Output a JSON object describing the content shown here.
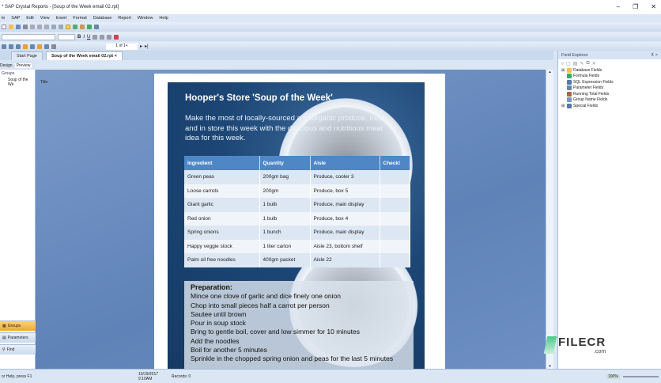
{
  "window": {
    "title": "* SAP Crystal Reports - [Soup of the Week email 02.rpt]"
  },
  "menu": [
    "le",
    "SAP",
    "Edit",
    "View",
    "Insert",
    "Format",
    "Database",
    "Report",
    "Window",
    "Help"
  ],
  "toolbar": {
    "page_indicator": "1 of 1+"
  },
  "tabs": [
    {
      "label": "Start Page"
    },
    {
      "label": "Soup of the Week email 02.rpt"
    }
  ],
  "view_tabs": [
    "Design",
    "Preview"
  ],
  "left_panel": {
    "header": "Groups",
    "tree_item": "Soup of the We",
    "buttons": [
      "Groups",
      "Parameters",
      "Find"
    ]
  },
  "main": {
    "field_label": "Title"
  },
  "report": {
    "title": "Hooper's Store 'Soup of the Week'",
    "intro": "Make the most of locally-sourced and organic produce, fresh and in store this week with the delicious and nutritious meal idea for this week.",
    "columns": [
      "Ingredient",
      "Quantity",
      "Aisle",
      "Check!"
    ],
    "rows": [
      [
        "Green peas",
        "200gm bag",
        "Produce, cooler 3",
        ""
      ],
      [
        "Loose carrots",
        "200gm",
        "Produce, box 5",
        ""
      ],
      [
        "Giant garlic",
        "1 bulb",
        "Produce, main display",
        ""
      ],
      [
        "Red onion",
        "1 bulb",
        "Produce, box 4",
        ""
      ],
      [
        "Spring onions",
        "1 bunch",
        "Produce, main display",
        ""
      ],
      [
        "Happy veggie stock",
        "1 liter carton",
        "Aisle 23, bottom shelf",
        ""
      ],
      [
        "Palm oil free noodles",
        "400gm packet",
        "Aisle 22",
        ""
      ]
    ],
    "prep_heading": "Preparation:",
    "steps": [
      "Mince one clove of garlic and dice finely one onion",
      "Chop into small pieces half a carrot per person",
      "Sautee until brown",
      "Pour in soup stock",
      "Bring to gentle boil, cover and low simmer for 10 minutes",
      "Add the noodles",
      "Boil for another 5 minutes",
      "Sprinkle in the chopped spring onion and peas for the last 5 minutes"
    ]
  },
  "field_explorer": {
    "title": "Field Explorer",
    "items": [
      "Database Fields",
      "Formula Fields",
      "SQL Expression Fields",
      "Parameter Fields",
      "Running Total Fields",
      "Group Name Fields",
      "Special Fields"
    ]
  },
  "status": {
    "help": "or Help, press F1",
    "datetime": "10/19/2017  9:10AM",
    "records": "Records: 0",
    "zoom": "100%"
  },
  "watermark": {
    "brand": "FILECR",
    ".com": ".com"
  },
  "colors": {
    "header": "#4f86c6",
    "accent": "#f5b942"
  }
}
